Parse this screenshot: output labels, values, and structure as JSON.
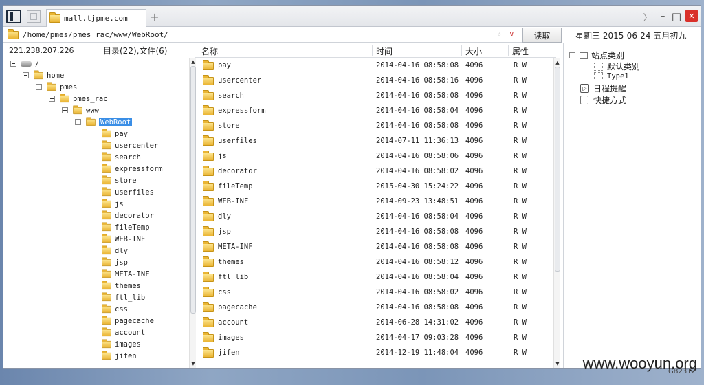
{
  "titlebar": {
    "tab_label": "mall.tjpme.com",
    "add_tab": "+",
    "forward": "〉",
    "minimize": "–",
    "maximize": "□",
    "close": "✕"
  },
  "address": {
    "path": "/home/pmes/pmes_rac/www/WebRoot/",
    "star": "☆",
    "dropdown": "∨",
    "read_button": "读取"
  },
  "status": {
    "date": "星期三 2015-06-24 五月初九",
    "ip": "221.238.207.226",
    "counts": "目录(22),文件(6)"
  },
  "columns": {
    "name": "名称",
    "time": "时间",
    "size": "大小",
    "attr": "属性"
  },
  "tree": {
    "root": "/",
    "home": "home",
    "pmes": "pmes",
    "pmes_rac": "pmes_rac",
    "www": "www",
    "webroot": "WebRoot",
    "children": [
      "pay",
      "usercenter",
      "search",
      "expressform",
      "store",
      "userfiles",
      "js",
      "decorator",
      "fileTemp",
      "WEB-INF",
      "dly",
      "jsp",
      "META-INF",
      "themes",
      "ftl_lib",
      "css",
      "pagecache",
      "account",
      "images",
      "jifen"
    ]
  },
  "files": [
    {
      "name": "pay",
      "time": "2014-04-16 08:58:08",
      "size": "4096",
      "attr": "R W"
    },
    {
      "name": "usercenter",
      "time": "2014-04-16 08:58:16",
      "size": "4096",
      "attr": "R W"
    },
    {
      "name": "search",
      "time": "2014-04-16 08:58:08",
      "size": "4096",
      "attr": "R W"
    },
    {
      "name": "expressform",
      "time": "2014-04-16 08:58:04",
      "size": "4096",
      "attr": "R W"
    },
    {
      "name": "store",
      "time": "2014-04-16 08:58:08",
      "size": "4096",
      "attr": "R W"
    },
    {
      "name": "userfiles",
      "time": "2014-07-11 11:36:13",
      "size": "4096",
      "attr": "R W"
    },
    {
      "name": "js",
      "time": "2014-04-16 08:58:06",
      "size": "4096",
      "attr": "R W"
    },
    {
      "name": "decorator",
      "time": "2014-04-16 08:58:02",
      "size": "4096",
      "attr": "R W"
    },
    {
      "name": "fileTemp",
      "time": "2015-04-30 15:24:22",
      "size": "4096",
      "attr": "R W"
    },
    {
      "name": "WEB-INF",
      "time": "2014-09-23 13:48:51",
      "size": "4096",
      "attr": "R W"
    },
    {
      "name": "dly",
      "time": "2014-04-16 08:58:04",
      "size": "4096",
      "attr": "R W"
    },
    {
      "name": "jsp",
      "time": "2014-04-16 08:58:08",
      "size": "4096",
      "attr": "R W"
    },
    {
      "name": "META-INF",
      "time": "2014-04-16 08:58:08",
      "size": "4096",
      "attr": "R W"
    },
    {
      "name": "themes",
      "time": "2014-04-16 08:58:12",
      "size": "4096",
      "attr": "R W"
    },
    {
      "name": "ftl_lib",
      "time": "2014-04-16 08:58:04",
      "size": "4096",
      "attr": "R W"
    },
    {
      "name": "css",
      "time": "2014-04-16 08:58:02",
      "size": "4096",
      "attr": "R W"
    },
    {
      "name": "pagecache",
      "time": "2014-04-16 08:58:08",
      "size": "4096",
      "attr": "R W"
    },
    {
      "name": "account",
      "time": "2014-06-28 14:31:02",
      "size": "4096",
      "attr": "R W"
    },
    {
      "name": "images",
      "time": "2014-04-17 09:03:28",
      "size": "4096",
      "attr": "R W"
    },
    {
      "name": "jifen",
      "time": "2014-12-19 11:48:04",
      "size": "4096",
      "attr": "R W"
    }
  ],
  "right_panel": {
    "site_category": "站点类别",
    "default_category": "默认类别",
    "type1": "Type1",
    "schedule": "日程提醒",
    "shortcuts": "快捷方式"
  },
  "watermark": {
    "site": "www.wooyun.org",
    "code": "GB2312"
  },
  "colors": {
    "selection": "#3a8ee6",
    "folder": "#eab534",
    "close": "#d9302a"
  }
}
